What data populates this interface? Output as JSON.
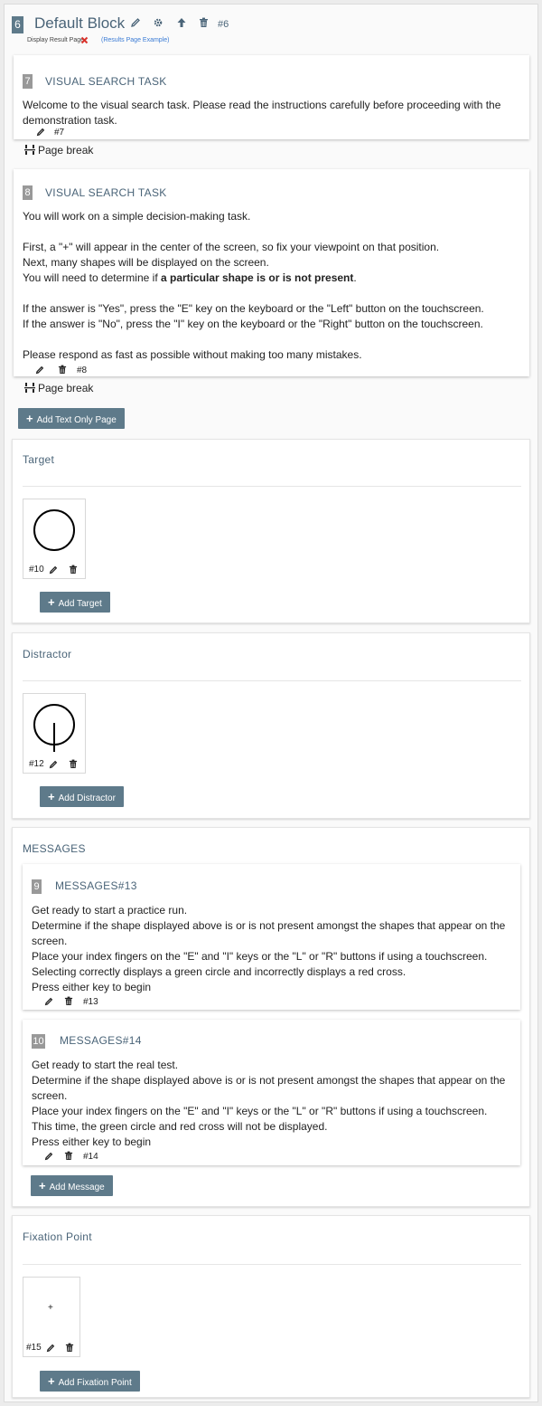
{
  "block": {
    "number": "6",
    "title": "Default Block",
    "id": "#6",
    "display_result": "Display Result Page",
    "results_example": "(Results Page Example)"
  },
  "card7": {
    "number": "7",
    "title": "VISUAL SEARCH TASK",
    "text": "Welcome to the visual search task. Please read the instructions carefully before proceeding with the demonstration task.",
    "id": "#7"
  },
  "page_break": "Page break",
  "card8": {
    "number": "8",
    "title": "VISUAL SEARCH TASK",
    "line1": "You will work on a simple decision-making task.",
    "line2": "First, a \"+\" will appear in the center of the screen, so fix your viewpoint on that position.",
    "line3": "Next, many shapes will be displayed on the screen.",
    "line4a": "You will need to determine if ",
    "line4b": "a particular shape is or is not present",
    "line4c": ".",
    "line5": "If the answer is \"Yes\", press the \"E\" key on the keyboard or the \"Left\" button on the touchscreen.",
    "line6": "If the answer is \"No\", press the \"I\" key on the keyboard or the \"Right\" button on the touchscreen.",
    "line7": "Please respond as fast as possible without making too many mistakes.",
    "id": "#8"
  },
  "add_text_only_page": "Add Text Only Page",
  "target": {
    "title": "Target",
    "item_id": "#10",
    "add_label": "Add Target"
  },
  "distractor": {
    "title": "Distractor",
    "item_id": "#12",
    "add_label": "Add Distractor"
  },
  "messages": {
    "title": "MESSAGES",
    "m13": {
      "number": "9",
      "title": "MESSAGES#13",
      "l1": "Get ready to start a practice run.",
      "l2": "Determine if the shape displayed above is or is not present amongst the shapes that appear on the screen.",
      "l3": "Place your index fingers on the \"E\" and \"I\" keys or the \"L\" or \"R\" buttons if using a touchscreen.",
      "l4": "Selecting correctly displays a green circle and incorrectly displays a red cross.",
      "l5": "Press either key to begin",
      "id": "#13"
    },
    "m14": {
      "number": "10",
      "title": "MESSAGES#14",
      "l1": "Get ready to start the real test.",
      "l2": "Determine if the shape displayed above is or is not present amongst the shapes that appear on the screen.",
      "l3": "Place your index fingers on the \"E\" and \"I\" keys or the \"L\" or \"R\" buttons if using a touchscreen.",
      "l4": "This time, the green circle and red cross will not be displayed.",
      "l5": "Press either key to begin",
      "id": "#14"
    },
    "add_label": "Add Message"
  },
  "fixation": {
    "title": "Fixation Point",
    "symbol": "+",
    "item_id": "#15",
    "add_label": "Add Fixation Point"
  },
  "colors": {
    "accent": "#4a6478",
    "button": "#5e7a8a",
    "badge": "#999999",
    "error": "#d9322b"
  },
  "icons": [
    "pencil-icon",
    "gear-icon",
    "arrow-up-icon",
    "trash-icon",
    "close-icon",
    "plus-icon",
    "page-break-icon"
  ]
}
